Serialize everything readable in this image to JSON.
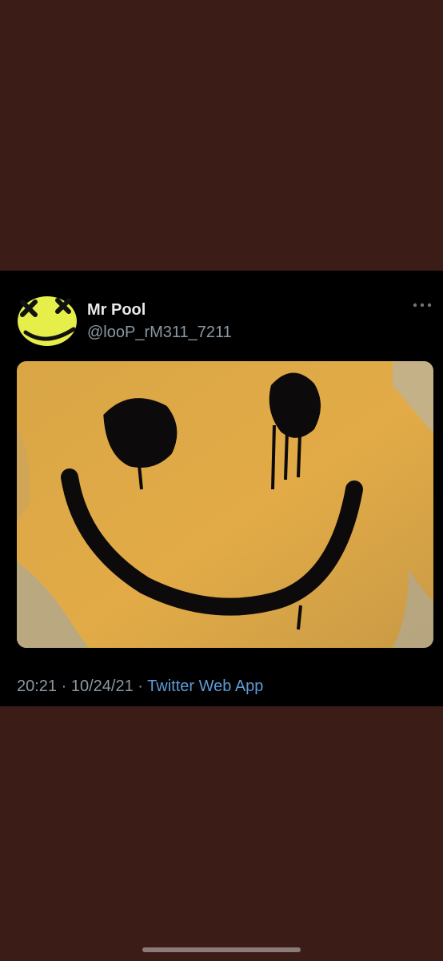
{
  "tweet": {
    "display_name": "Mr Pool",
    "handle": "@looP_rM311_7211",
    "more_icon": "more-horizontal-icon",
    "time": "20:21",
    "date": "10/24/21",
    "separator": "·",
    "source": "Twitter Web App",
    "media": {
      "icon": "graffiti-smiley-photo"
    }
  },
  "colors": {
    "background": "#3c1c16",
    "card": "#000000",
    "display_name": "#e7e9ea",
    "secondary_text": "#8b98a5",
    "link": "#5d9ad6",
    "smiley_yellow": "#e0a93e"
  }
}
